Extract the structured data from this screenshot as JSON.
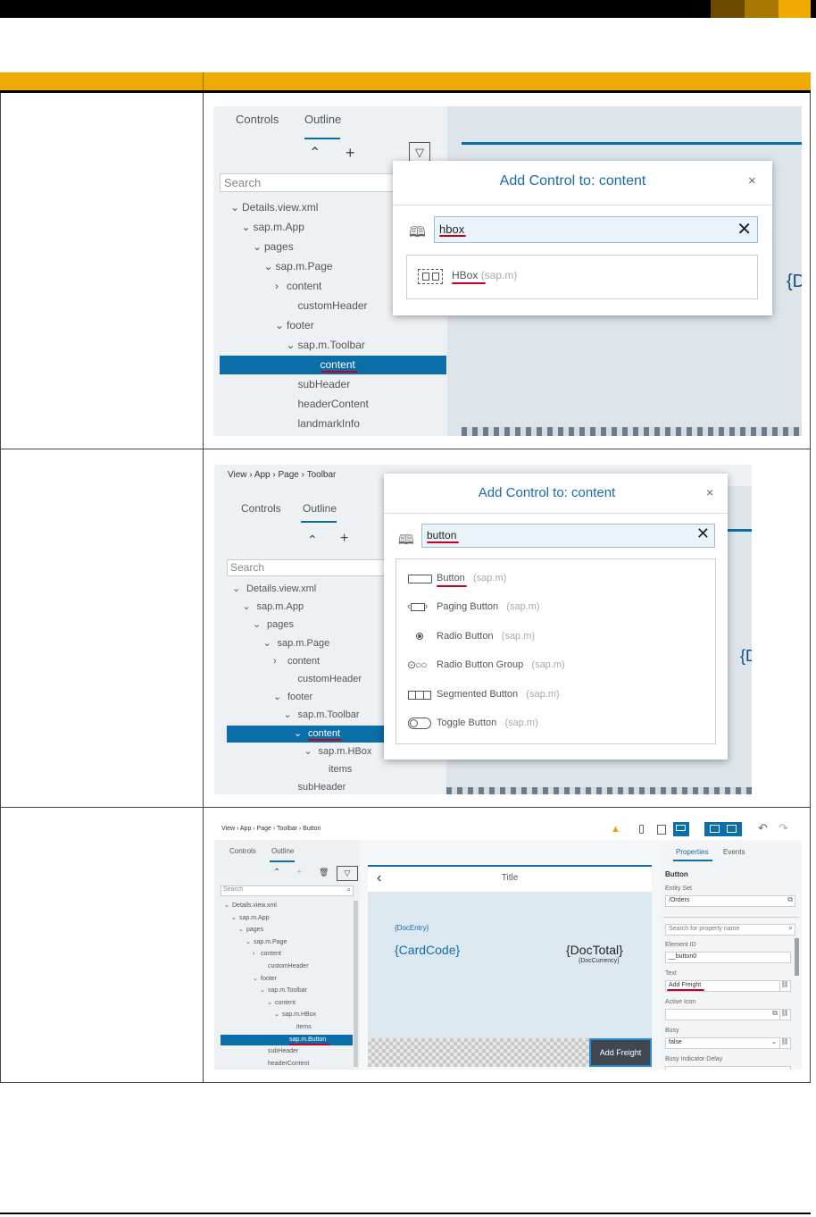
{
  "colors": {
    "header": "#f0ab00",
    "sapBlue": "#0a6ea8",
    "underline": "#c4001b"
  },
  "shot1": {
    "tabs": [
      "Controls",
      "Outline"
    ],
    "search_placeholder": "Search",
    "tree": [
      "Details.view.xml",
      "sap.m.App",
      "pages",
      "sap.m.Page",
      "content",
      "customHeader",
      "footer",
      "sap.m.Toolbar",
      "content",
      "subHeader",
      "headerContent",
      "landmarkInfo"
    ],
    "dialog": {
      "title": "Add Control to: content",
      "query": "hbox",
      "results": [
        {
          "name": "HBox",
          "lib": "(sap.m)"
        }
      ]
    },
    "bg_text": "{D"
  },
  "shot2": {
    "breadcrumb": "View › App › Page › Toolbar",
    "tabs": [
      "Controls",
      "Outline"
    ],
    "search_placeholder": "Search",
    "tree": [
      "Details.view.xml",
      "sap.m.App",
      "pages",
      "sap.m.Page",
      "content",
      "customHeader",
      "footer",
      "sap.m.Toolbar",
      "content",
      "sap.m.HBox",
      "items",
      "subHeader"
    ],
    "dialog": {
      "title": "Add Control to: content",
      "query": "button",
      "results": [
        {
          "name": "Button",
          "lib": "(sap.m)"
        },
        {
          "name": "Paging Button",
          "lib": "(sap.m)"
        },
        {
          "name": "Radio Button",
          "lib": "(sap.m)"
        },
        {
          "name": "Radio Button Group",
          "lib": "(sap.m)"
        },
        {
          "name": "Segmented Button",
          "lib": "(sap.m)"
        },
        {
          "name": "Toggle Button",
          "lib": "(sap.m)"
        }
      ]
    },
    "bg_text": "{D"
  },
  "shot3": {
    "breadcrumb": "View › App › Page › Toolbar › Button",
    "tabs": [
      "Controls",
      "Outline"
    ],
    "search_placeholder": "Search",
    "tree": [
      "Details.view.xml",
      "sap.m.App",
      "pages",
      "sap.m.Page",
      "content",
      "customHeader",
      "footer",
      "sap.m.Toolbar",
      "content",
      "sap.m.HBox",
      "items",
      "sap.m.Button",
      "subHeader",
      "headerContent"
    ],
    "canvas": {
      "title": "Title",
      "doc_entry": "{DocEntry}",
      "card_code": "{CardCode}",
      "doc_total": "{DocTotal}",
      "doc_currency": "{DocCurrency}",
      "button": "Add Freight"
    },
    "props": {
      "tabs": [
        "Properties",
        "Events"
      ],
      "heading": "Button",
      "entity_set_label": "Entity Set",
      "entity_set": "/Orders",
      "search_placeholder": "Search for property name",
      "element_id_label": "Element ID",
      "element_id": "__button0",
      "text_label": "Text",
      "text": "Add Freight",
      "active_icon_label": "Active Icon",
      "busy_label": "Busy",
      "busy": "false",
      "busy_delay_label": "Busy Indicator Delay"
    }
  }
}
